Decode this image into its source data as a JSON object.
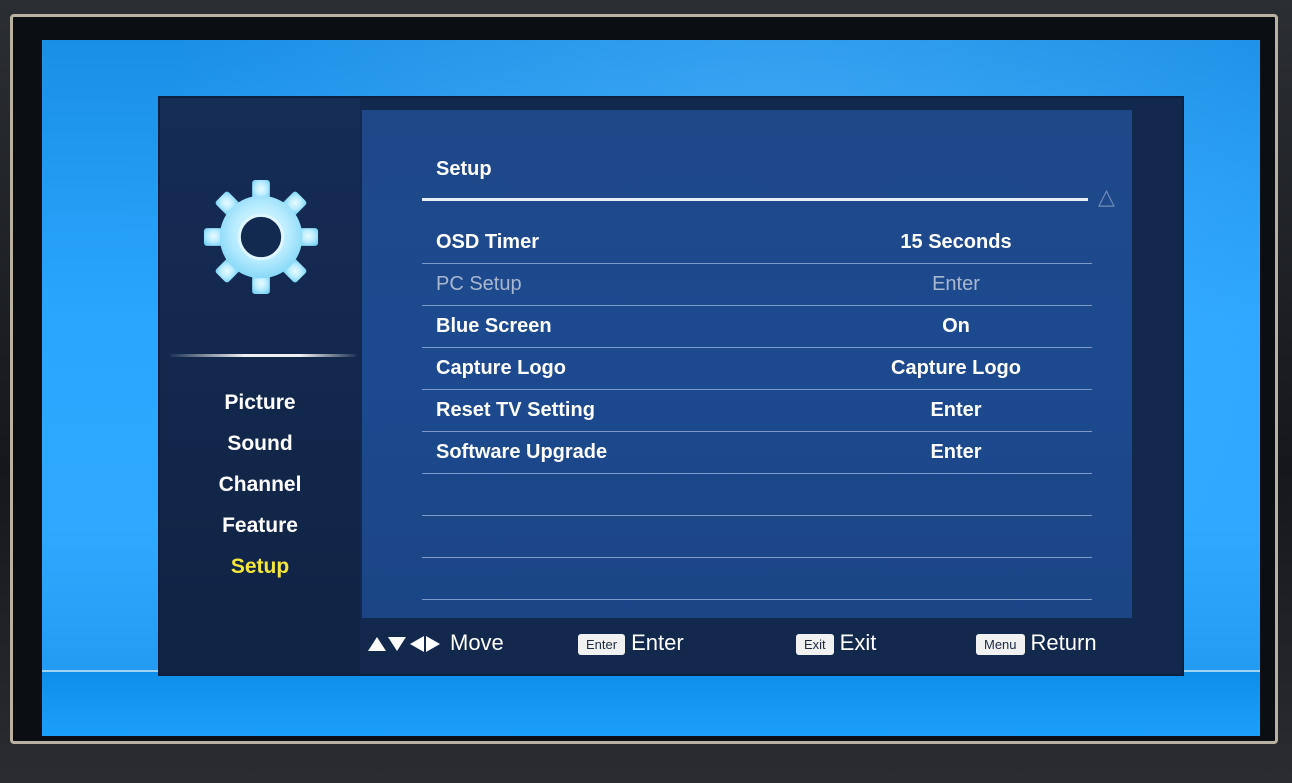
{
  "sidebar": {
    "icon": "gear-icon",
    "items": [
      {
        "label": "Picture"
      },
      {
        "label": "Sound"
      },
      {
        "label": "Channel"
      },
      {
        "label": "Feature"
      },
      {
        "label": "Setup",
        "active": true
      }
    ],
    "active_color": "#f5e73a"
  },
  "panel": {
    "title": "Setup",
    "rows": [
      {
        "label": "OSD Timer",
        "value": "15 Seconds",
        "enabled": true
      },
      {
        "label": "PC Setup",
        "value": "Enter",
        "enabled": false
      },
      {
        "label": "Blue Screen",
        "value": "On",
        "enabled": true
      },
      {
        "label": "Capture Logo",
        "value": "Capture Logo",
        "enabled": true
      },
      {
        "label": "Reset TV Setting",
        "value": "Enter",
        "enabled": true
      },
      {
        "label": "Software Upgrade",
        "value": "Enter",
        "enabled": true
      },
      {
        "label": "",
        "value": ""
      },
      {
        "label": "",
        "value": ""
      },
      {
        "label": "",
        "value": ""
      }
    ]
  },
  "hints": {
    "move_icon": "arrow-keys-icon",
    "move_label": "Move",
    "enter_key": "Enter",
    "enter_label": "Enter",
    "exit_key": "Exit",
    "exit_label": "Exit",
    "menu_key": "Menu",
    "menu_label": "Return"
  },
  "colors": {
    "screen_blue": "#2aa6ff",
    "osd_background": "#13284d",
    "panel_background": "#1d4a8f"
  }
}
